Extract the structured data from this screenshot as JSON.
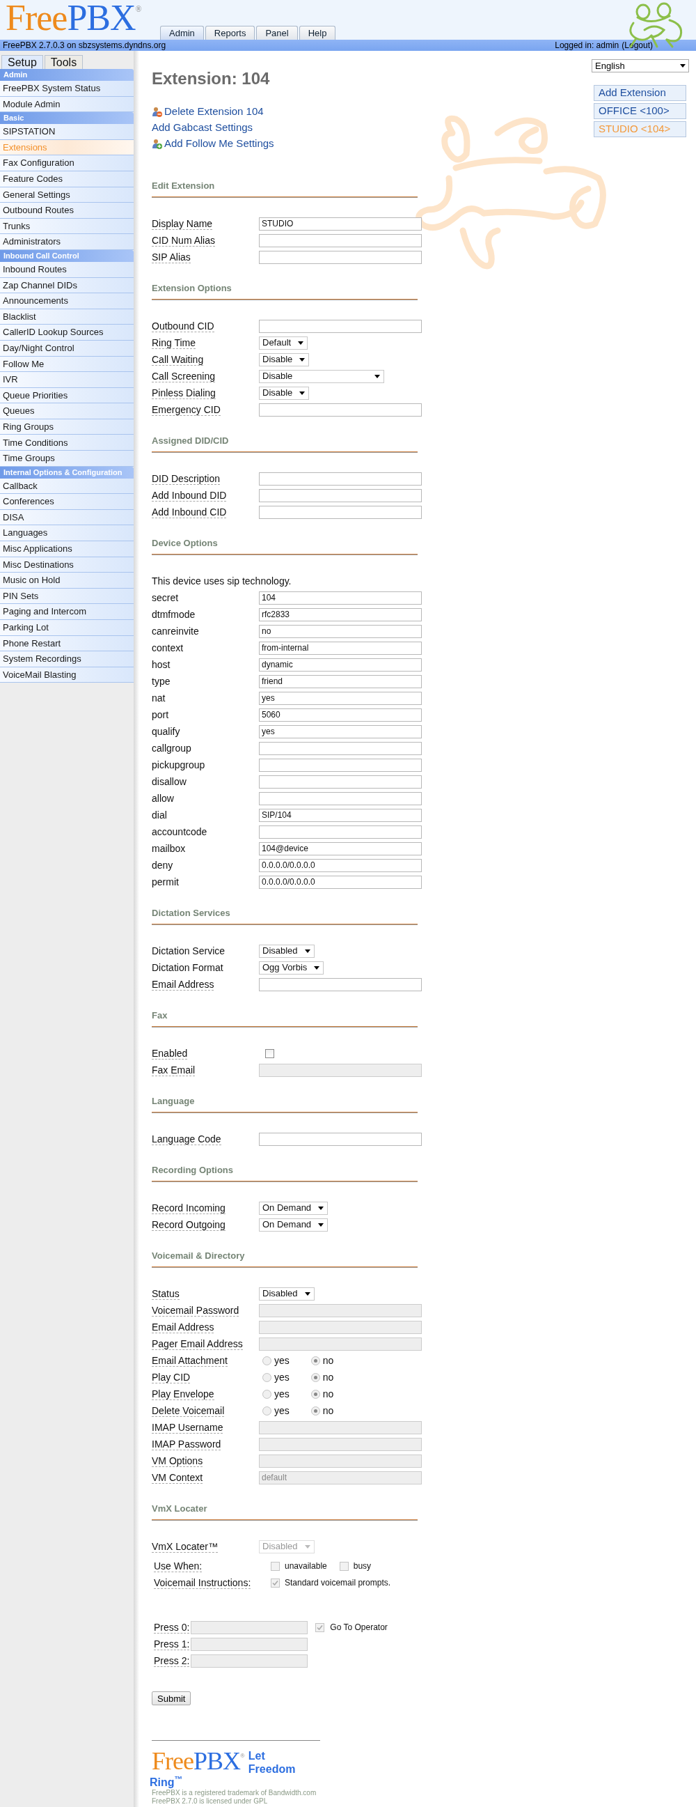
{
  "header": {
    "logo": {
      "first": "Free",
      "second": "PBX",
      "mark": "®"
    },
    "tabs": [
      {
        "label": "Admin",
        "selected": true
      },
      {
        "label": "Reports",
        "selected": false
      },
      {
        "label": "Panel",
        "selected": false
      },
      {
        "label": "Help",
        "selected": false
      }
    ],
    "version": "FreePBX 2.7.0.3 on sbzsystems.dyndns.org",
    "login": "Logged in: admin",
    "logout": "(Logout)"
  },
  "sidebar": {
    "tabs": [
      {
        "label": "Setup",
        "selected": true
      },
      {
        "label": "Tools",
        "selected": false
      }
    ],
    "groups": [
      {
        "title": "Admin",
        "items": [
          {
            "label": "FreePBX System Status",
            "selected": false
          },
          {
            "label": "Module Admin",
            "selected": false
          }
        ]
      },
      {
        "title": "Basic",
        "items": [
          {
            "label": "SIPSTATION",
            "selected": false
          },
          {
            "label": "Extensions",
            "selected": true
          },
          {
            "label": "Fax Configuration",
            "selected": false
          },
          {
            "label": "Feature Codes",
            "selected": false
          },
          {
            "label": "General Settings",
            "selected": false
          },
          {
            "label": "Outbound Routes",
            "selected": false
          },
          {
            "label": "Trunks",
            "selected": false
          },
          {
            "label": "Administrators",
            "selected": false
          }
        ]
      },
      {
        "title": "Inbound Call Control",
        "items": [
          {
            "label": "Inbound Routes",
            "selected": false
          },
          {
            "label": "Zap Channel DIDs",
            "selected": false
          },
          {
            "label": "Announcements",
            "selected": false
          },
          {
            "label": "Blacklist",
            "selected": false
          },
          {
            "label": "CallerID Lookup Sources",
            "selected": false
          },
          {
            "label": "Day/Night Control",
            "selected": false
          },
          {
            "label": "Follow Me",
            "selected": false
          },
          {
            "label": "IVR",
            "selected": false
          },
          {
            "label": "Queue Priorities",
            "selected": false
          },
          {
            "label": "Queues",
            "selected": false
          },
          {
            "label": "Ring Groups",
            "selected": false
          },
          {
            "label": "Time Conditions",
            "selected": false
          },
          {
            "label": "Time Groups",
            "selected": false
          }
        ]
      },
      {
        "title": "Internal Options & Configuration",
        "items": [
          {
            "label": "Callback",
            "selected": false
          },
          {
            "label": "Conferences",
            "selected": false
          },
          {
            "label": "DISA",
            "selected": false
          },
          {
            "label": "Languages",
            "selected": false
          },
          {
            "label": "Misc Applications",
            "selected": false
          },
          {
            "label": "Misc Destinations",
            "selected": false
          },
          {
            "label": "Music on Hold",
            "selected": false
          },
          {
            "label": "PIN Sets",
            "selected": false
          },
          {
            "label": "Paging and Intercom",
            "selected": false
          },
          {
            "label": "Parking Lot",
            "selected": false
          },
          {
            "label": "Phone Restart",
            "selected": false
          },
          {
            "label": "System Recordings",
            "selected": false
          },
          {
            "label": "VoiceMail Blasting",
            "selected": false
          }
        ]
      }
    ]
  },
  "language": {
    "value": "English"
  },
  "nav": [
    {
      "label": "Add Extension",
      "selected": false
    },
    {
      "label": "OFFICE <100>",
      "selected": false
    },
    {
      "label": "STUDIO <104>",
      "selected": true
    }
  ],
  "title": "Extension: 104",
  "links": [
    {
      "label": "Delete Extension 104",
      "kind": "remove"
    },
    {
      "label": "Add Gabcast Settings",
      "kind": "plain"
    },
    {
      "label": "Add Follow Me Settings",
      "kind": "add"
    }
  ],
  "sections": [
    {
      "title": "Edit Extension",
      "rows": [
        {
          "kind": "text",
          "label": "Display Name",
          "help": true,
          "value": "STUDIO"
        },
        {
          "kind": "text",
          "label": "CID Num Alias",
          "help": true
        },
        {
          "kind": "text",
          "label": "SIP Alias",
          "help": true
        }
      ]
    },
    {
      "title": "Extension Options",
      "rows": [
        {
          "kind": "text",
          "label": "Outbound CID",
          "help": true
        },
        {
          "kind": "select",
          "label": "Ring Time",
          "help": true,
          "value": "Default"
        },
        {
          "kind": "select",
          "label": "Call Waiting",
          "help": true,
          "value": "Disable"
        },
        {
          "kind": "select",
          "label": "Call Screening",
          "help": true,
          "value": "Disable",
          "wide": true
        },
        {
          "kind": "select",
          "label": "Pinless Dialing",
          "help": true,
          "value": "Disable"
        },
        {
          "kind": "text",
          "label": "Emergency CID",
          "help": true
        }
      ]
    },
    {
      "title": "Assigned DID/CID",
      "rows": [
        {
          "kind": "text",
          "label": "DID Description",
          "help": true
        },
        {
          "kind": "text",
          "label": "Add Inbound DID",
          "help": true
        },
        {
          "kind": "text",
          "label": "Add Inbound CID",
          "help": true
        }
      ]
    },
    {
      "title": "Device Options",
      "rows": [
        {
          "kind": "note",
          "label": "This device uses sip technology."
        },
        {
          "kind": "text",
          "label": "secret",
          "help": false,
          "value": "104"
        },
        {
          "kind": "text",
          "label": "dtmfmode",
          "help": false,
          "value": "rfc2833"
        },
        {
          "kind": "text",
          "label": "canreinvite",
          "help": false,
          "value": "no"
        },
        {
          "kind": "text",
          "label": "context",
          "help": false,
          "value": "from-internal"
        },
        {
          "kind": "text",
          "label": "host",
          "help": false,
          "value": "dynamic"
        },
        {
          "kind": "text",
          "label": "type",
          "help": false,
          "value": "friend"
        },
        {
          "kind": "text",
          "label": "nat",
          "help": false,
          "value": "yes"
        },
        {
          "kind": "text",
          "label": "port",
          "help": false,
          "value": "5060"
        },
        {
          "kind": "text",
          "label": "qualify",
          "help": false,
          "value": "yes"
        },
        {
          "kind": "text",
          "label": "callgroup",
          "help": false
        },
        {
          "kind": "text",
          "label": "pickupgroup",
          "help": false
        },
        {
          "kind": "text",
          "label": "disallow",
          "help": false
        },
        {
          "kind": "text",
          "label": "allow",
          "help": false
        },
        {
          "kind": "text",
          "label": "dial",
          "help": false,
          "value": "SIP/104"
        },
        {
          "kind": "text",
          "label": "accountcode",
          "help": false
        },
        {
          "kind": "text",
          "label": "mailbox",
          "help": false,
          "value": "104@device"
        },
        {
          "kind": "text",
          "label": "deny",
          "help": false,
          "value": "0.0.0.0/0.0.0.0"
        },
        {
          "kind": "text",
          "label": "permit",
          "help": false,
          "value": "0.0.0.0/0.0.0.0"
        }
      ]
    },
    {
      "title": "Dictation Services",
      "rows": [
        {
          "kind": "select",
          "label": "Dictation Service",
          "help": false,
          "value": "Disabled"
        },
        {
          "kind": "select",
          "label": "Dictation Format",
          "help": false,
          "value": "Ogg Vorbis"
        },
        {
          "kind": "text",
          "label": "Email Address",
          "help": true
        }
      ]
    },
    {
      "title": "Fax",
      "rows": [
        {
          "kind": "checkbox",
          "label": "Enabled",
          "help": true,
          "checked": false
        },
        {
          "kind": "text",
          "label": "Fax Email",
          "help": true,
          "disabled": true
        }
      ]
    },
    {
      "title": "Language",
      "rows": [
        {
          "kind": "text",
          "label": "Language Code",
          "help": true
        }
      ]
    },
    {
      "title": "Recording Options",
      "rows": [
        {
          "kind": "select",
          "label": "Record Incoming",
          "help": true,
          "value": "On Demand"
        },
        {
          "kind": "select",
          "label": "Record Outgoing",
          "help": true,
          "value": "On Demand"
        }
      ]
    },
    {
      "title": "Voicemail & Directory",
      "rows": [
        {
          "kind": "select",
          "label": "Status",
          "help": true,
          "value": "Disabled"
        },
        {
          "kind": "text",
          "label": "Voicemail Password",
          "help": true,
          "disabled": true
        },
        {
          "kind": "text",
          "label": "Email Address",
          "help": true,
          "disabled": true
        },
        {
          "kind": "text",
          "label": "Pager Email Address",
          "help": true,
          "disabled": true
        },
        {
          "kind": "radio",
          "label": "Email Attachment",
          "help": true,
          "options": [
            {
              "label": "yes",
              "selected": false
            },
            {
              "label": "no",
              "selected": true
            }
          ]
        },
        {
          "kind": "radio",
          "label": "Play CID",
          "help": true,
          "options": [
            {
              "label": "yes",
              "selected": false
            },
            {
              "label": "no",
              "selected": true
            }
          ]
        },
        {
          "kind": "radio",
          "label": "Play Envelope",
          "help": true,
          "options": [
            {
              "label": "yes",
              "selected": false
            },
            {
              "label": "no",
              "selected": true
            }
          ]
        },
        {
          "kind": "radio",
          "label": "Delete Voicemail",
          "help": true,
          "options": [
            {
              "label": "yes",
              "selected": false
            },
            {
              "label": "no",
              "selected": true
            }
          ]
        },
        {
          "kind": "text",
          "label": "IMAP Username",
          "help": true,
          "disabled": true
        },
        {
          "kind": "text",
          "label": "IMAP Password",
          "help": true,
          "disabled": true
        },
        {
          "kind": "text",
          "label": "VM Options",
          "help": true,
          "disabled": true
        },
        {
          "kind": "text",
          "label": "VM Context",
          "help": true,
          "disabled": true,
          "value": "default"
        }
      ]
    },
    {
      "title": "VmX Locater",
      "rows": [
        {
          "kind": "select",
          "label": "VmX Locater™",
          "help": true,
          "value": "Disabled",
          "disabled": true
        },
        {
          "kind": "checks",
          "label": "Use When:",
          "help": true,
          "disabled": true,
          "options": [
            {
              "label": "unavailable",
              "checked": false
            },
            {
              "label": "busy",
              "checked": false
            }
          ]
        },
        {
          "kind": "checks",
          "label": "Voicemail Instructions:",
          "help": true,
          "disabled": true,
          "options": [
            {
              "label": "Standard voicemail prompts.",
              "checked": true
            }
          ]
        }
      ]
    }
  ],
  "press": [
    {
      "label": "Press 0:",
      "help": true,
      "disabled": true,
      "option": {
        "label": "Go To Operator",
        "checked": true
      }
    },
    {
      "label": "Press 1:",
      "help": true,
      "disabled": true
    },
    {
      "label": "Press 2:",
      "help": true,
      "disabled": true
    }
  ],
  "submit": "Submit",
  "footer": {
    "logo": {
      "first": "Free",
      "second": "PBX",
      "mark": "®"
    },
    "slogan": [
      "Let",
      "Freedom",
      "Ring$^{™}$"
    ],
    "notes": [
      "FreePBX is a registered trademark of Bandwidth.com",
      "FreePBX 2.7.0 is licensed under GPL"
    ]
  }
}
